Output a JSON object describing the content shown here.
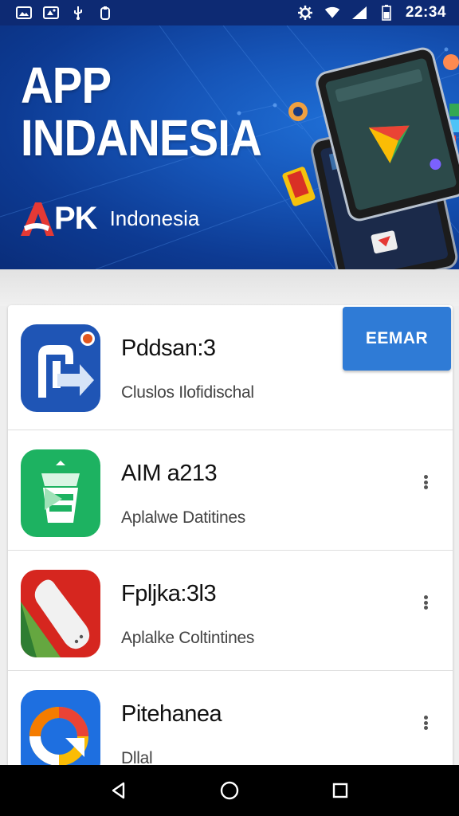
{
  "status_bar": {
    "time": "22:34",
    "left_icons": [
      "gallery-icon",
      "image-icon",
      "usb-icon",
      "clipboard-icon"
    ],
    "right_icons": [
      "settings-icon",
      "wifi-icon",
      "signal-icon",
      "battery-icon"
    ]
  },
  "banner": {
    "title_line1": "APP",
    "title_line2": "INDANESIA",
    "brand_apk": "PK",
    "brand_name": "Indonesia"
  },
  "apps": [
    {
      "name": "Pddsan:3",
      "subtitle": "Cluslos Ilofidischal",
      "icon": "door-arrow-icon",
      "action_label": "EEMAR"
    },
    {
      "name": "AIM a213",
      "subtitle": "Aplalwe Datitines",
      "icon": "trash-bin-icon"
    },
    {
      "name": "Fpljka:3l3",
      "subtitle": "Aplalke Coltintines",
      "icon": "phone-handset-icon"
    },
    {
      "name": "Pitehanea",
      "subtitle": "Dllal",
      "icon": "color-ring-icon"
    }
  ],
  "colors": {
    "status_bar": "#0d2a73",
    "banner": "#1655b8",
    "action_button": "#2f7bd6",
    "app1_icon": "#1f55b5",
    "app2_icon": "#1db261",
    "app3_icon": "#d6261f",
    "app4_icon": "#1e6fe0"
  },
  "nav_bar": {
    "buttons": [
      "back-icon",
      "home-icon",
      "recents-icon"
    ]
  }
}
